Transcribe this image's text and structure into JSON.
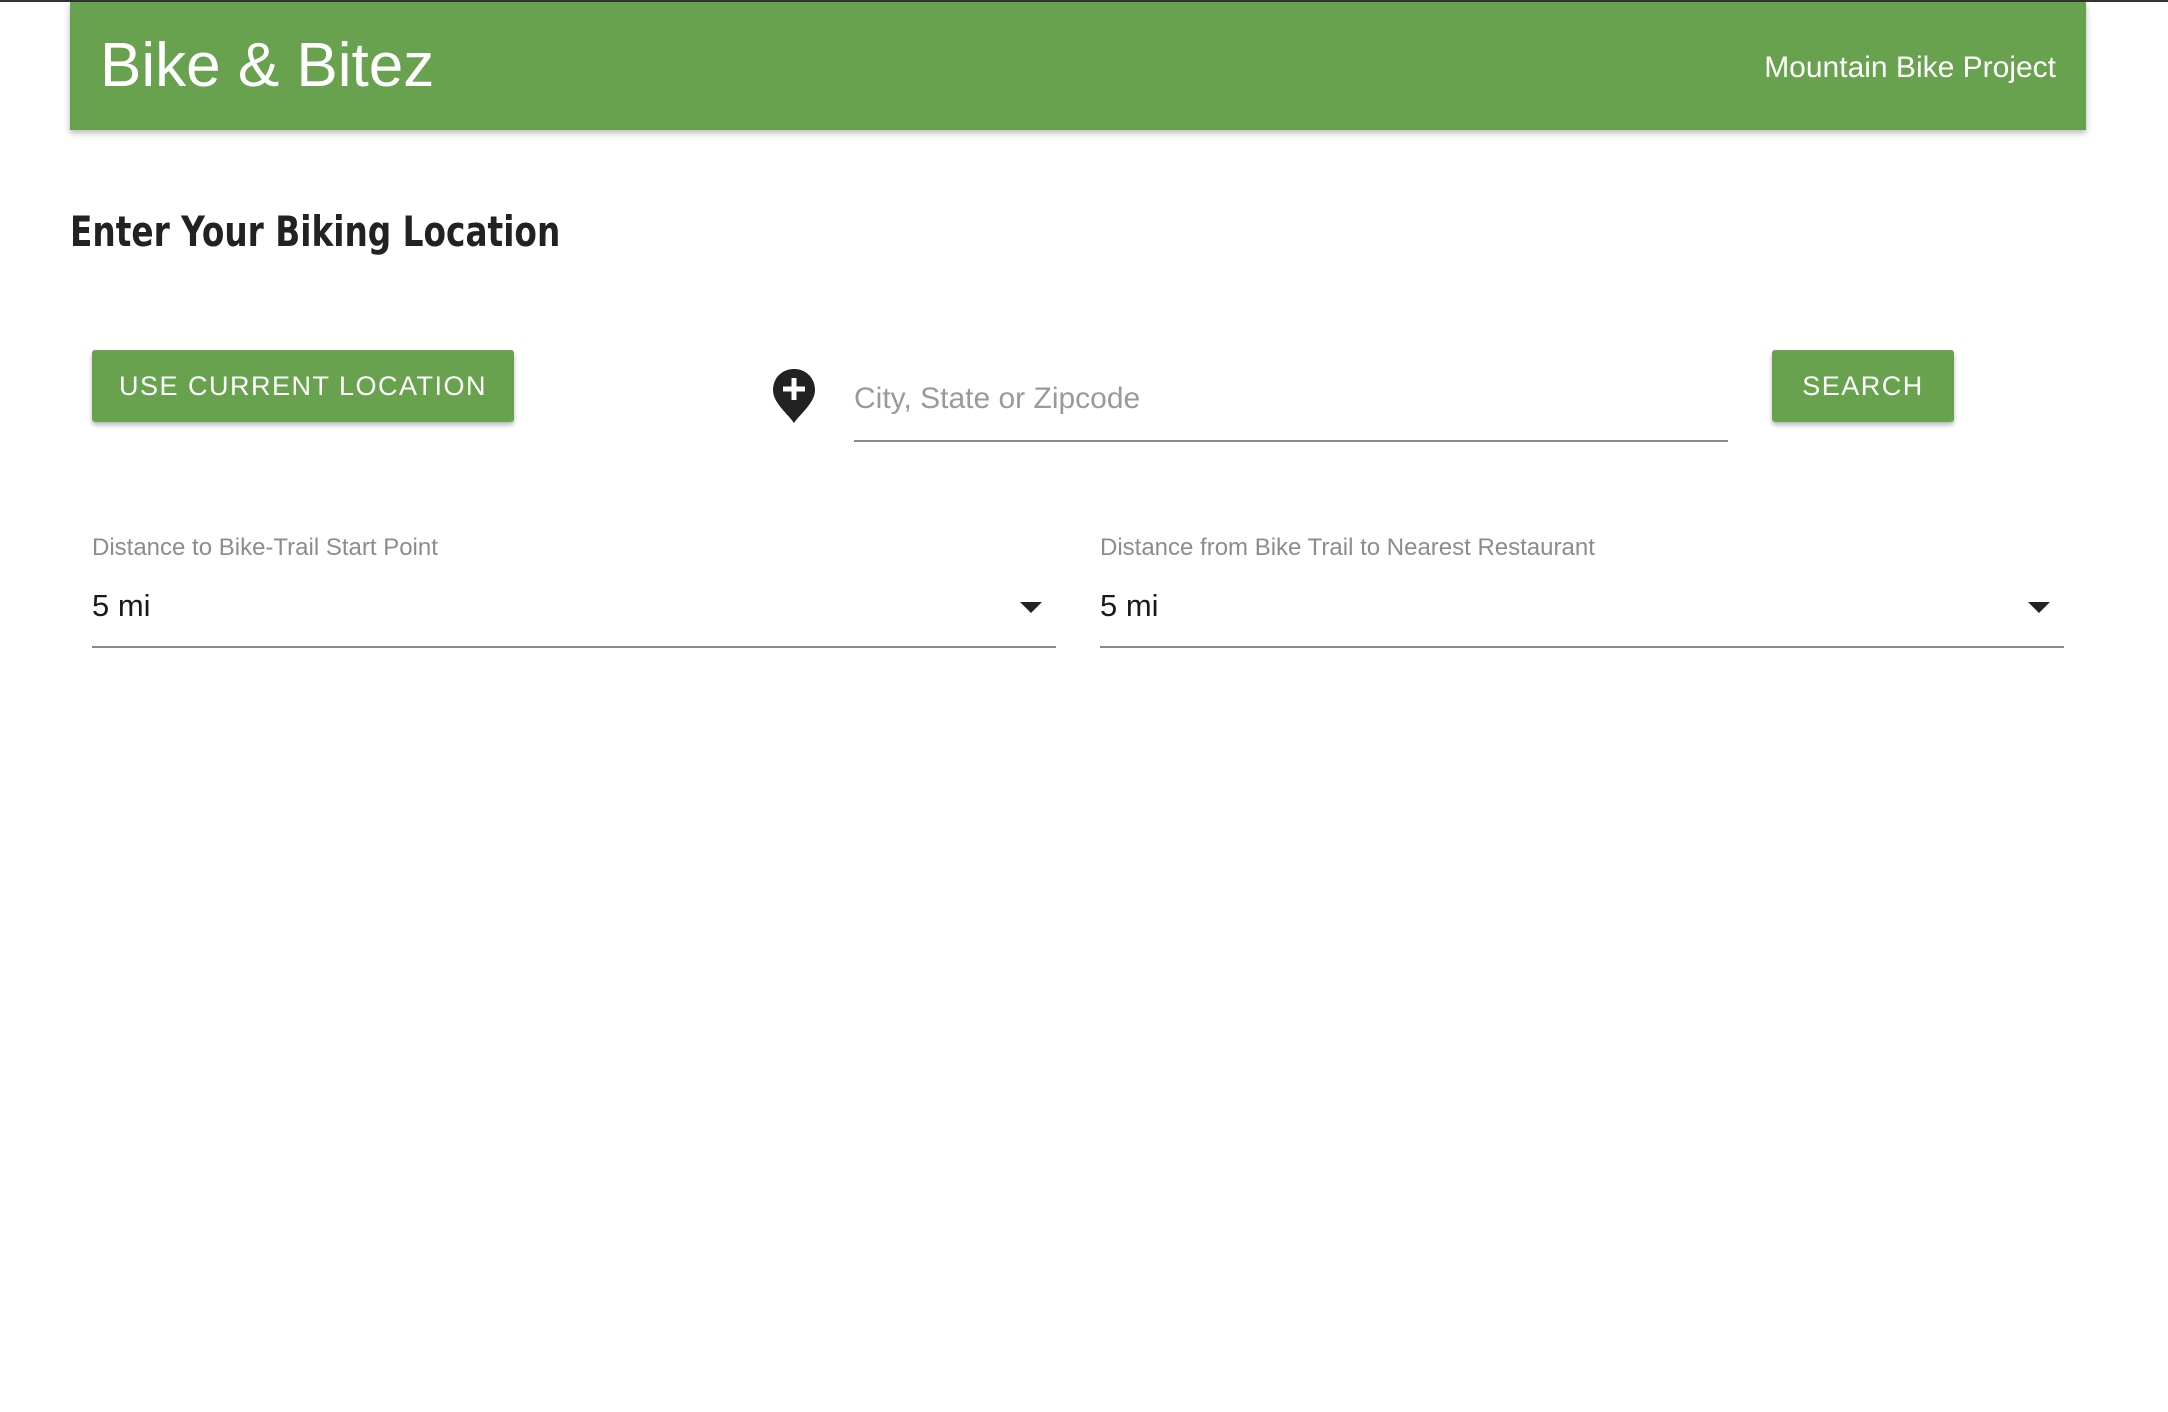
{
  "header": {
    "app_title": "Bike & Bitez",
    "nav_link": "Mountain Bike Project"
  },
  "main": {
    "heading": "Enter Your Biking Location",
    "use_location_label": "USE CURRENT LOCATION",
    "search_label": "SEARCH",
    "location_input": {
      "value": "",
      "placeholder": "City, State or Zipcode"
    },
    "trail_distance": {
      "label": "Distance to Bike-Trail Start Point",
      "value": "5 mi"
    },
    "restaurant_distance": {
      "label": "Distance from Bike Trail to Nearest Restaurant",
      "value": "5 mi"
    }
  },
  "icons": {
    "location": "add-location-pin-icon",
    "dropdown": "arrow-drop-down-icon"
  },
  "colors": {
    "primary": "#69a24f",
    "text_dark": "#222222",
    "label_gray": "#8c8c8c"
  }
}
